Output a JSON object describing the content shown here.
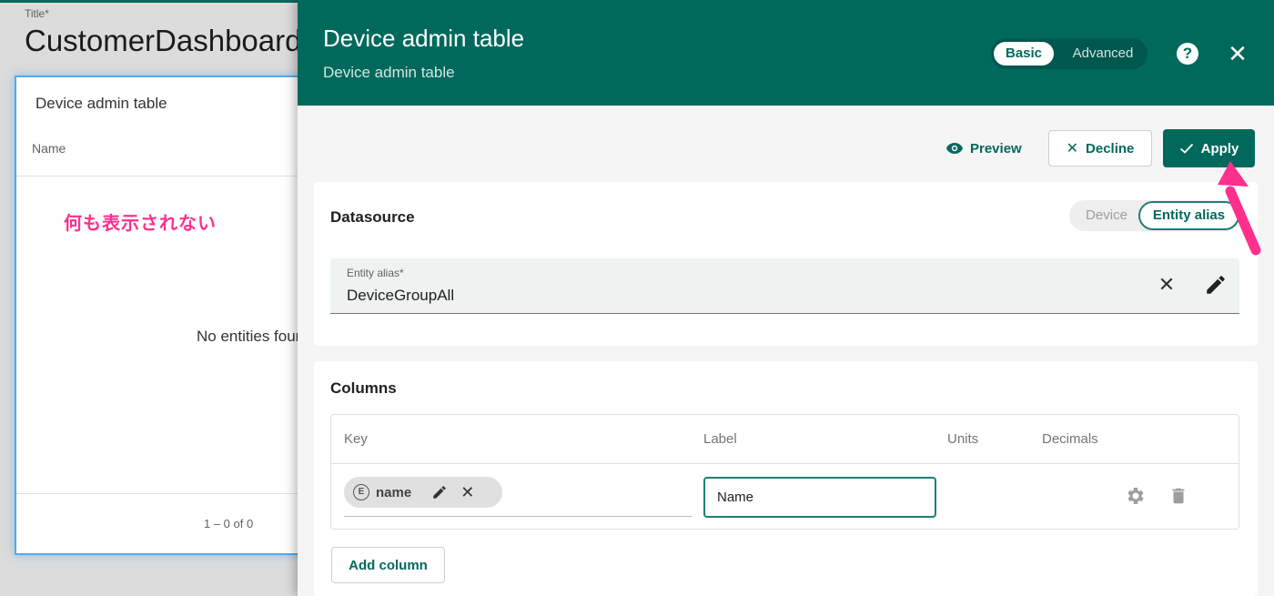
{
  "background": {
    "title_label": "Title*",
    "title_value": "CustomerDashboard",
    "widget": {
      "title": "Device admin table",
      "column_header": "Name",
      "annotation": "何も表示されない",
      "empty_message": "No entities found",
      "pagination": "1 – 0 of 0"
    }
  },
  "dialog": {
    "title": "Device admin table",
    "subtitle": "Device admin table",
    "mode_toggle": {
      "basic": "Basic",
      "advanced": "Advanced",
      "selected": "Basic"
    },
    "help_icon": "help-circle-icon",
    "close_icon": "close-icon",
    "actions": {
      "preview": "Preview",
      "decline": "Decline",
      "apply": "Apply"
    },
    "datasource": {
      "title": "Datasource",
      "type_toggle": {
        "device": "Device",
        "entity_alias": "Entity alias",
        "selected": "Entity alias"
      },
      "entity_alias_label": "Entity alias*",
      "entity_alias_value": "DeviceGroupAll"
    },
    "columns": {
      "title": "Columns",
      "headers": {
        "key": "Key",
        "label": "Label",
        "units": "Units",
        "decimals": "Decimals"
      },
      "rows": [
        {
          "key_type": "E",
          "key": "name",
          "label": "Name",
          "units": "",
          "decimals": ""
        }
      ],
      "add_button": "Add column"
    },
    "colors": {
      "primary": "#00695c",
      "annotation": "#ff2f8e",
      "widget_border": "#5aa9e6"
    }
  }
}
